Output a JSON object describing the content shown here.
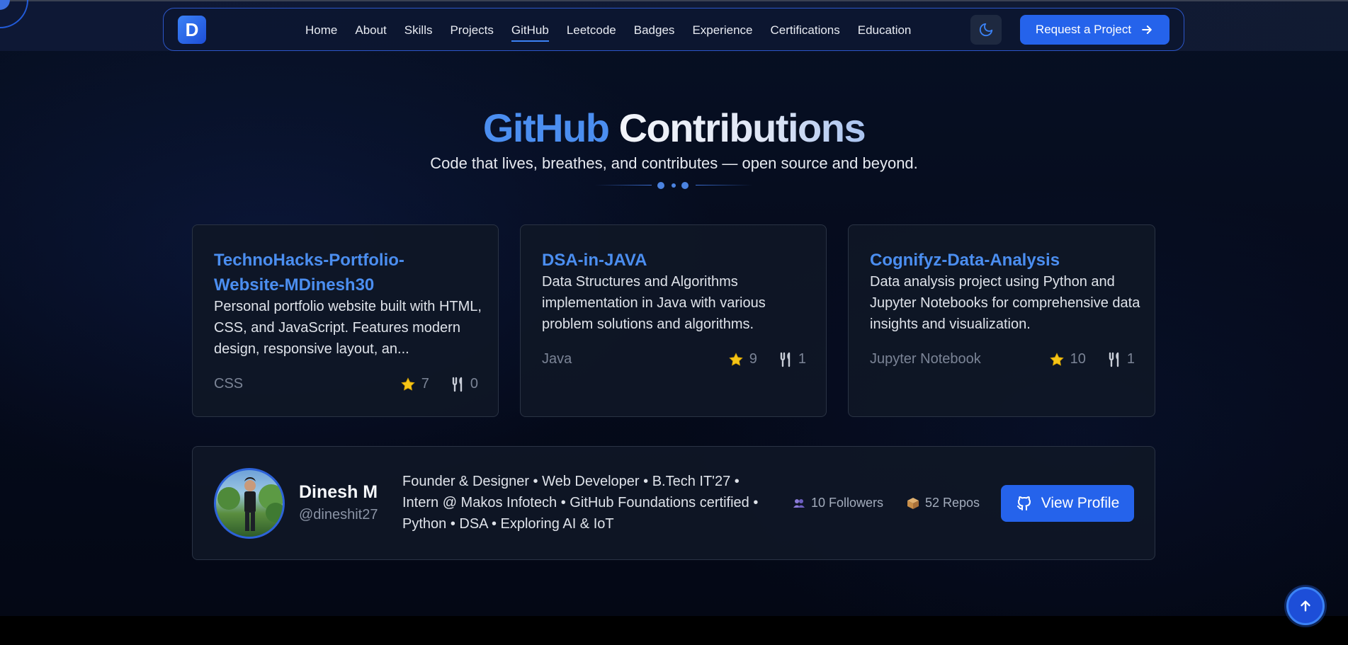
{
  "nav": {
    "logo_letter": "D",
    "links": [
      "Home",
      "About",
      "Skills",
      "Projects",
      "GitHub",
      "Leetcode",
      "Badges",
      "Experience",
      "Certifications",
      "Education"
    ],
    "active": "GitHub",
    "cta_label": "Request a Project"
  },
  "header": {
    "title_part1": "GitHub",
    "title_part2": "Contributions",
    "subtitle": "Code that lives, breathes, and contributes — open source and beyond."
  },
  "repos": [
    {
      "title": "TechnoHacks-Portfolio-Website-MDinesh30",
      "title_line1": "TechnoHacks-Portfolio-",
      "title_line2": "Website-MDinesh30",
      "description": "Personal portfolio website built with HTML, CSS, and JavaScript. Features modern design, responsive layout, an...",
      "language": "CSS",
      "stars": "7",
      "forks": "0"
    },
    {
      "title": "DSA-in-JAVA",
      "description": "Data Structures and Algorithms implementation in Java with various problem solutions and algorithms.",
      "language": "Java",
      "stars": "9",
      "forks": "1"
    },
    {
      "title": "Cognifyz-Data-Analysis",
      "description": "Data analysis project using Python and Jupyter Notebooks for comprehensive data insights and visualization.",
      "language": "Jupyter Notebook",
      "stars": "10",
      "forks": "1"
    }
  ],
  "profile": {
    "name": "Dinesh M",
    "handle": "@dineshit27",
    "bio": "Founder & Designer • Web Developer • B.Tech IT'27 • Intern @ Makos Infotech • GitHub Foundations certified • Python • DSA • Exploring AI & IoT",
    "followers": "10 Followers",
    "repos": "52 Repos",
    "button_label": "View Profile"
  },
  "colors": {
    "accent": "#2563eb",
    "link": "#4b8ef0",
    "star": "#f5c518"
  }
}
